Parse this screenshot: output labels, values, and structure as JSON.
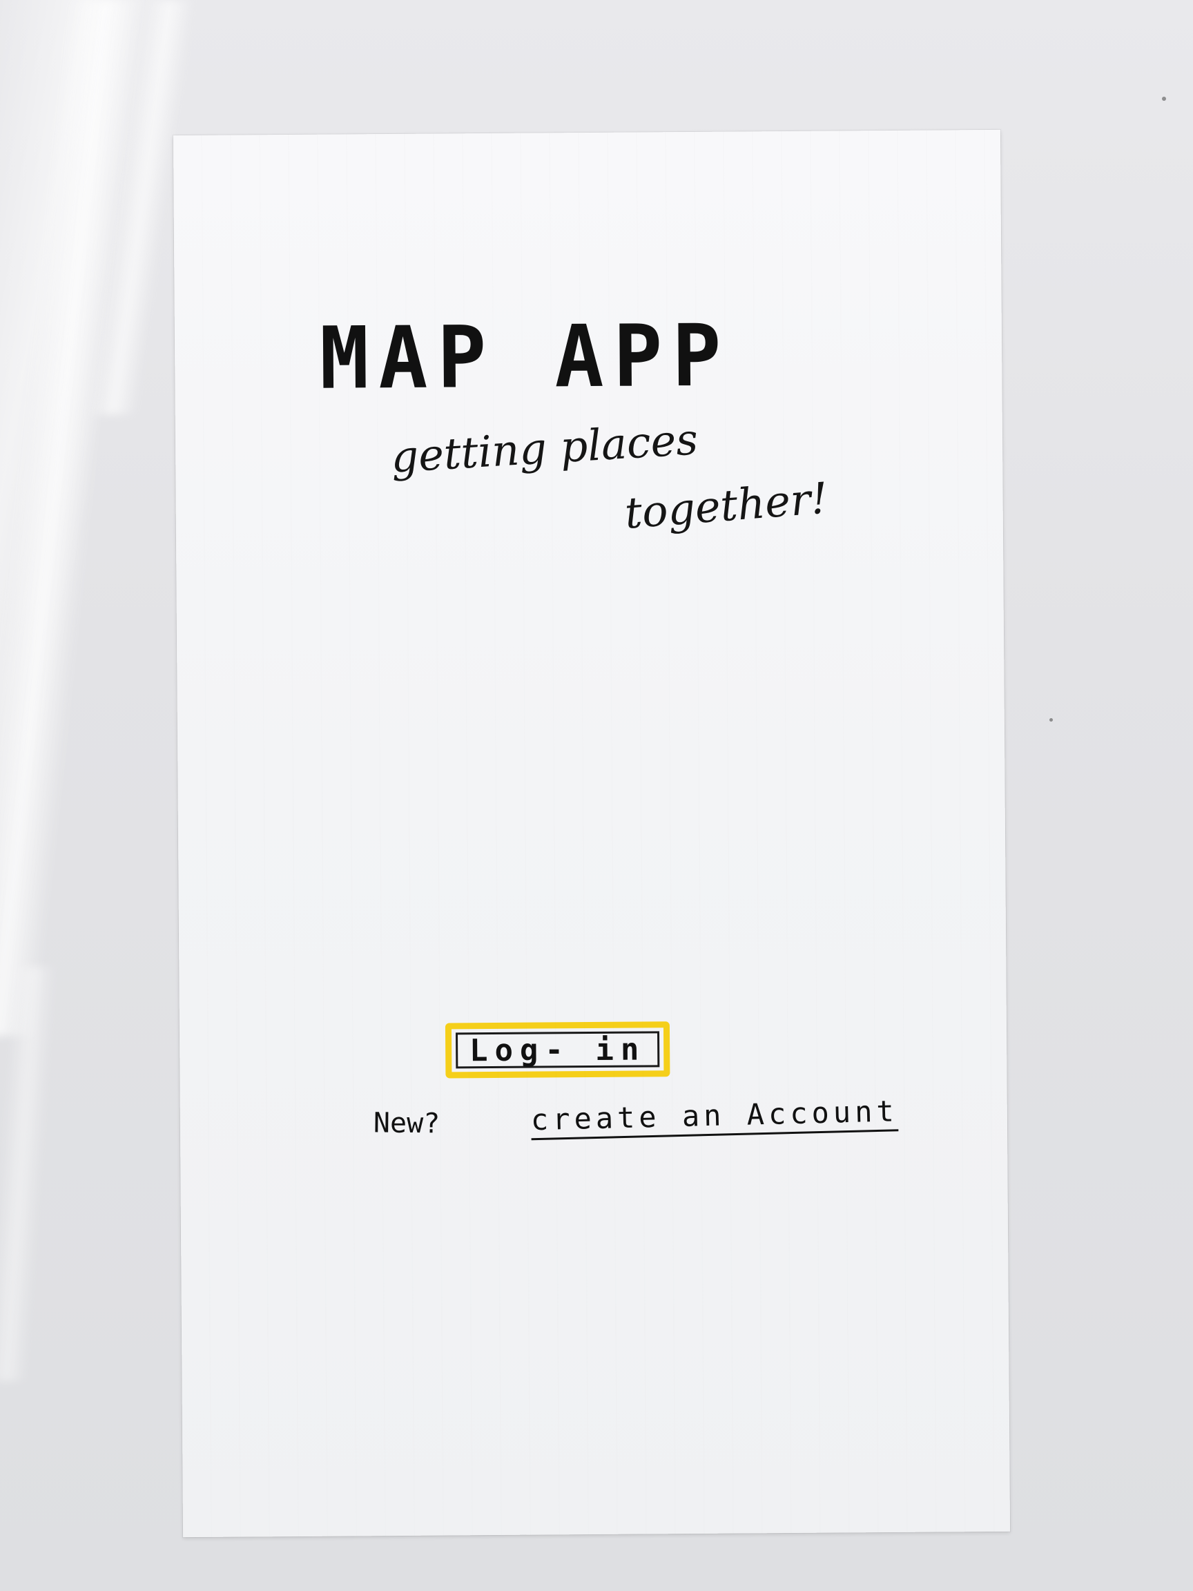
{
  "screen": {
    "title": "MAP APP",
    "tagline_line1": "getting places",
    "tagline_line2": "together!"
  },
  "actions": {
    "login_label": "Log- in",
    "new_prompt": "New?",
    "create_account_label": "create an Account"
  },
  "colors": {
    "highlight": "#f5cf1a",
    "ink": "#111111",
    "paper": "#f4f5f7"
  }
}
